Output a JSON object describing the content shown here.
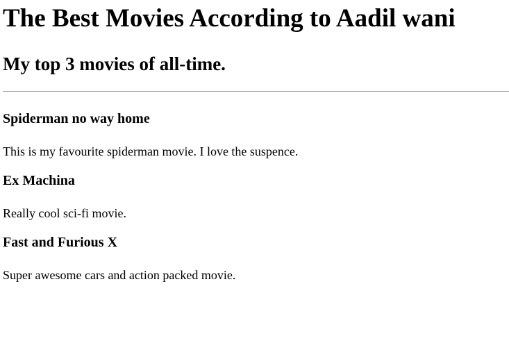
{
  "page": {
    "title": "The Best Movies According to Aadil wani",
    "subtitle": "My top 3 movies of all-time."
  },
  "movies": [
    {
      "title": "Spiderman no way home",
      "description": "This is my favourite spiderman movie. I love the suspence."
    },
    {
      "title": "Ex Machina",
      "description": "Really cool sci-fi movie."
    },
    {
      "title": "Fast and Furious X",
      "description": "Super awesome cars and action packed movie."
    }
  ]
}
